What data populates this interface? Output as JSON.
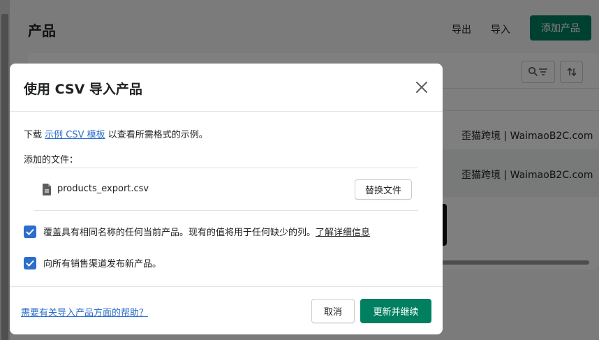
{
  "background": {
    "title": "产品",
    "export_label": "导出",
    "import_label": "导入",
    "add_product_label": "添加产品",
    "vendor_rows": [
      "歪猫跨境 | WaimaoB2C.com",
      "歪猫跨境 | WaimaoB2C.com"
    ]
  },
  "modal": {
    "title": "使用 CSV 导入产品",
    "download_prefix": "下载",
    "template_link": "示例 CSV 模板",
    "download_suffix": "以查看所需格式的示例。",
    "files_label": "添加的文件：",
    "file_name": "products_export.csv",
    "replace_label": "替换文件",
    "overwrite_text": "覆盖具有相同名称的任何当前产品。现有的值将用于任何缺少的列。",
    "learn_more_link": "了解详细信息",
    "overwrite_checked": true,
    "publish_text": "向所有销售渠道发布新产品。",
    "publish_checked": true,
    "help_link": "需要有关导入产品方面的帮助？",
    "cancel_label": "取消",
    "submit_label": "更新并继续"
  },
  "colors": {
    "primary": "#008060",
    "link": "#2c6ecb",
    "checkbox": "#2c6ecb"
  }
}
